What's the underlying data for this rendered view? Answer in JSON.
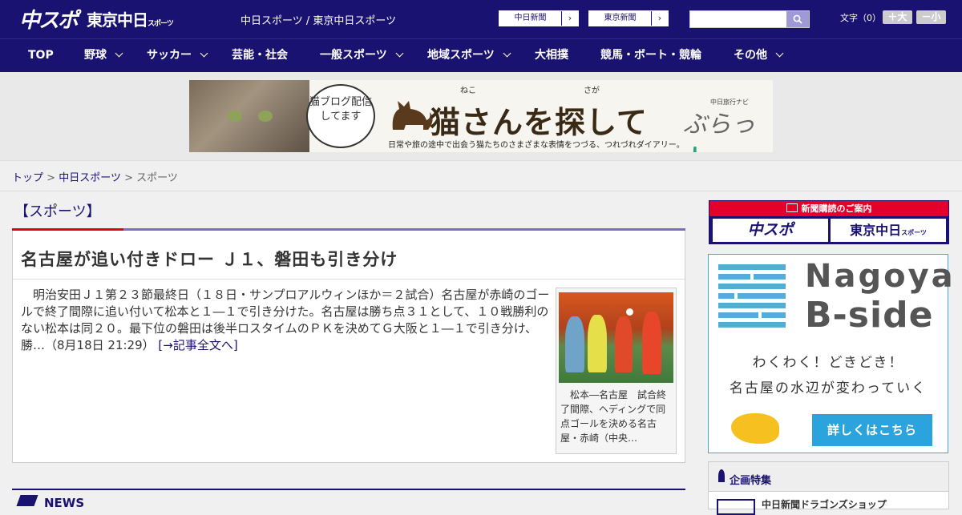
{
  "header": {
    "logo_main": "中スポ",
    "logo_tokyo": "東京中日",
    "logo_tokyo_sub": "スポーツ",
    "site_links": "中日スポーツ / 東京中日スポーツ",
    "paper1": "中日新聞",
    "paper2": "東京新聞",
    "fontsize_label": "文字（0）",
    "font_bigger": "＋大",
    "font_smaller": "－小"
  },
  "nav": [
    {
      "label": "TOP",
      "dropdown": false
    },
    {
      "label": "野球",
      "dropdown": true
    },
    {
      "label": "サッカー",
      "dropdown": true
    },
    {
      "label": "芸能・社会",
      "dropdown": false
    },
    {
      "label": "一般スポーツ",
      "dropdown": true
    },
    {
      "label": "地域スポーツ",
      "dropdown": true
    },
    {
      "label": "大相撲",
      "dropdown": false
    },
    {
      "label": "競馬・ボート・競輪",
      "dropdown": false
    },
    {
      "label": "その他",
      "dropdown": true
    }
  ],
  "banner": {
    "bubble": "猫ブログ配信してます",
    "headline": "猫さんを探して",
    "ruby_neko": "ねこ",
    "ruby_saga": "さが",
    "subline": "日常や旅の途中で出会う猫たちのさまざまな表情をつづる、つれづれダイアリー。",
    "navi_label": "中日旅行ナビ",
    "navi_a": "ぶらっ",
    "navi_b": "人"
  },
  "breadcrumb": {
    "top": "トップ",
    "sep": ">",
    "chunichi": "中日スポーツ",
    "current": "スポーツ"
  },
  "section_title": "【スポーツ】",
  "article": {
    "headline": "名古屋が追い付きドロー Ｊ１、磐田も引き分け",
    "body": "明治安田Ｊ１第２３節最終日（１８日・サンプロアルウィンほか＝２試合）名古屋が赤崎のゴールで終了間際に追い付いて松本と１―１で引き分けた。名古屋は勝ち点３１として、１０戦勝利のない松本は同２０。最下位の磐田は後半ロスタイムのＰＫを決めてＧ大阪と１―１で引き分け、勝…（8月18日 21:29）",
    "more": "[→記事全文へ]",
    "caption": "松本―名古屋　試合終了間際、ヘディングで同点ゴールを決める名古屋・赤崎（中央…"
  },
  "news_label": "NEWS",
  "sidebar": {
    "subscribe_title": "新聞購読のご案内",
    "sub_chuspo": "中スポ",
    "sub_tokyo": "東京中日",
    "sub_tokyo_small": "スポーツ",
    "nagoya_t1": "Nagoya",
    "nagoya_t2": "B-side",
    "nagoya_l1": "わくわく！どきどき！",
    "nagoya_l2": "名古屋の水辺が変わっていく",
    "nagoya_cta": "詳しくはこちら",
    "feature_title": "企画特集",
    "feature_item": "中日新聞ドラゴンズショップ"
  },
  "colors": {
    "brand_navy": "#1a1270",
    "accent_red": "#e2001a",
    "nagoya_blue": "#2ba3dc"
  }
}
